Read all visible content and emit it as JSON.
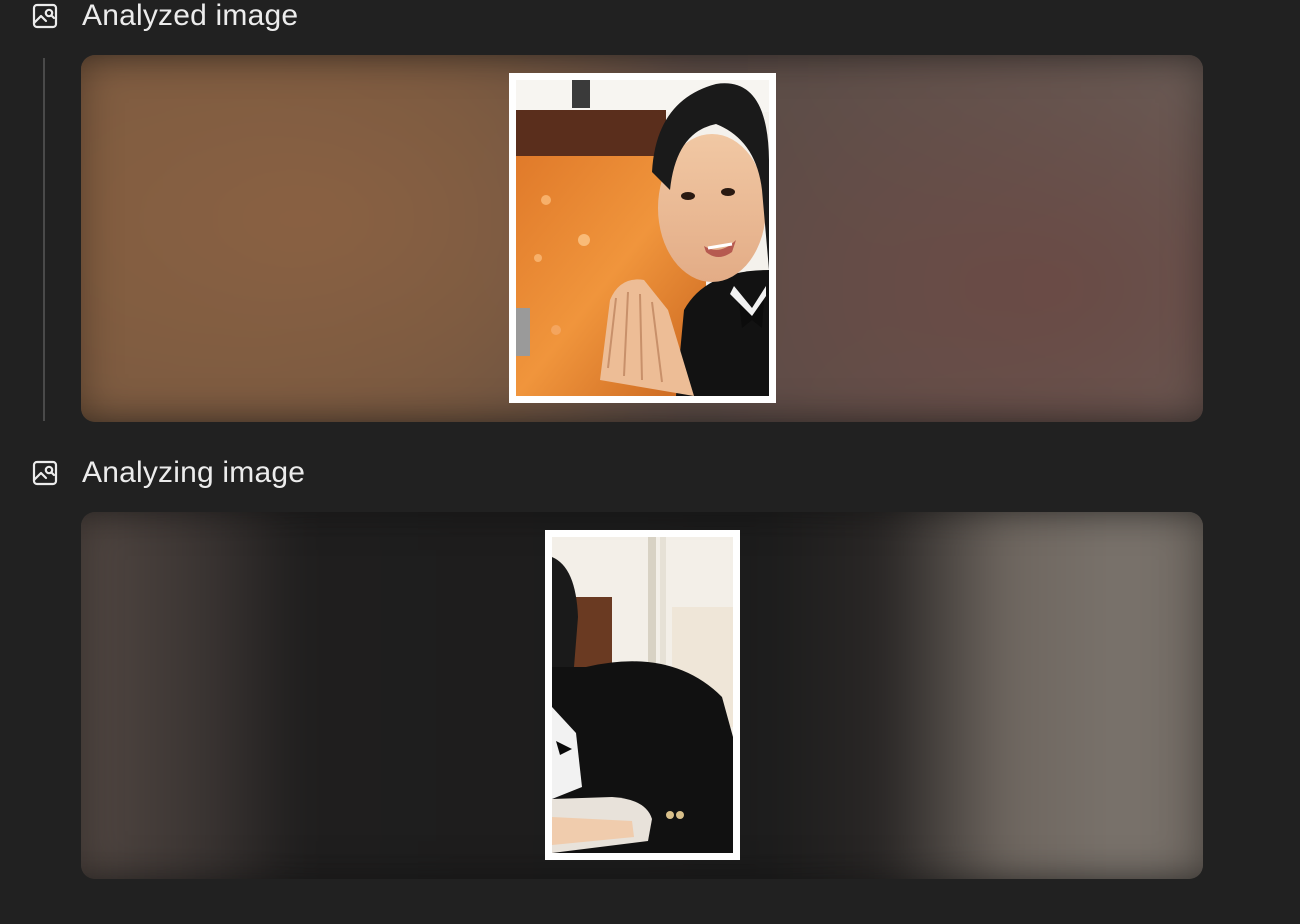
{
  "steps": [
    {
      "label": "Analyzed image",
      "icon": "image-search-icon",
      "status": "done"
    },
    {
      "label": "Analyzing image",
      "icon": "image-search-icon",
      "status": "in-progress"
    }
  ],
  "colors": {
    "background": "#212121",
    "text": "#ececec",
    "rail": "#4a4a4a",
    "thumb_border": "#ffffff"
  }
}
